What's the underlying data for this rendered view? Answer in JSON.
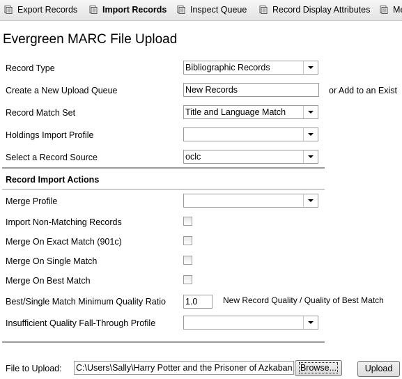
{
  "toolbar": {
    "items": [
      {
        "label": "Export Records",
        "icon": "document-icon",
        "active": false
      },
      {
        "label": "Import Records",
        "icon": "document-icon",
        "active": true
      },
      {
        "label": "Inspect Queue",
        "icon": "document-icon",
        "active": false
      },
      {
        "label": "Record Display Attributes",
        "icon": "document-icon",
        "active": false
      },
      {
        "label": "Me",
        "icon": "document-icon",
        "active": false
      }
    ]
  },
  "page_title": "Evergreen MARC File Upload",
  "form": {
    "record_type": {
      "label": "Record Type",
      "value": "Bibliographic Records"
    },
    "new_queue": {
      "label": "Create a New Upload Queue",
      "value": "New Records",
      "alt_text": "or Add to an Exist"
    },
    "match_set": {
      "label": "Record Match Set",
      "value": "Title and Language Match"
    },
    "holdings_profile": {
      "label": "Holdings Import Profile",
      "value": ""
    },
    "record_source": {
      "label": "Select a Record Source",
      "value": "oclc"
    }
  },
  "import_actions": {
    "heading": "Record Import Actions",
    "merge_profile": {
      "label": "Merge Profile",
      "value": ""
    },
    "import_non_matching": {
      "label": "Import Non-Matching Records",
      "checked": false
    },
    "merge_exact": {
      "label": "Merge On Exact Match (901c)",
      "checked": false
    },
    "merge_single": {
      "label": "Merge On Single Match",
      "checked": false
    },
    "merge_best": {
      "label": "Merge On Best Match",
      "checked": false
    },
    "quality_ratio": {
      "label": "Best/Single Match Minimum Quality Ratio",
      "value": "1.0",
      "note": "New Record Quality / Quality of Best Match"
    },
    "fallthrough_profile": {
      "label": "Insufficient Quality Fall-Through Profile",
      "value": ""
    }
  },
  "upload": {
    "label": "File to Upload:",
    "file_path": "C:\\Users\\Sally\\Harry Potter and the Prisoner of Azkaban.mrc",
    "browse_label": "Browse...",
    "upload_label": "Upload"
  }
}
